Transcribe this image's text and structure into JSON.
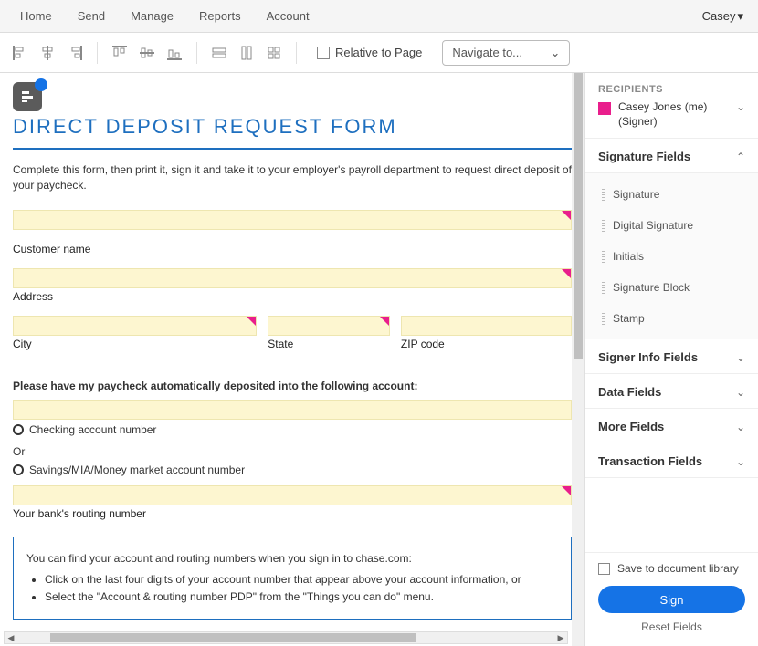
{
  "topnav": {
    "items": [
      "Home",
      "Send",
      "Manage",
      "Reports",
      "Account"
    ],
    "user": "Casey"
  },
  "toolbar": {
    "relative_label": "Relative to Page",
    "navigate_label": "Navigate to..."
  },
  "document": {
    "title": "DIRECT DEPOSIT REQUEST FORM",
    "intro": "Complete this form, then print it, sign it and take it to your employer's payroll department to request direct deposit of your paycheck.",
    "labels": {
      "customer": "Customer name",
      "address": "Address",
      "city": "City",
      "state": "State",
      "zip": "ZIP code",
      "section": "Please have my paycheck automatically deposited into the following account:",
      "checking": "Checking account number",
      "or": "Or",
      "savings": "Savings/MIA/Money market account number",
      "routing": "Your bank's routing number"
    },
    "info": {
      "lead": "You can find your account and routing numbers when you sign in to chase.com:",
      "b1": "Click on the last four digits of your account number that appear above your account information, or",
      "b2": "Select the \"Account & routing number PDP\" from the \"Things you can do\" menu."
    }
  },
  "side": {
    "recipients_head": "RECIPIENTS",
    "recipient_name": "Casey Jones (me)",
    "recipient_role": "(Signer)",
    "sections": {
      "sigfields": "Signature Fields",
      "signer": "Signer Info Fields",
      "data": "Data Fields",
      "more": "More Fields",
      "trans": "Transaction Fields"
    },
    "sig_items": [
      "Signature",
      "Digital Signature",
      "Initials",
      "Signature Block",
      "Stamp"
    ],
    "save_label": "Save to document library",
    "sign_btn": "Sign",
    "reset": "Reset Fields"
  }
}
